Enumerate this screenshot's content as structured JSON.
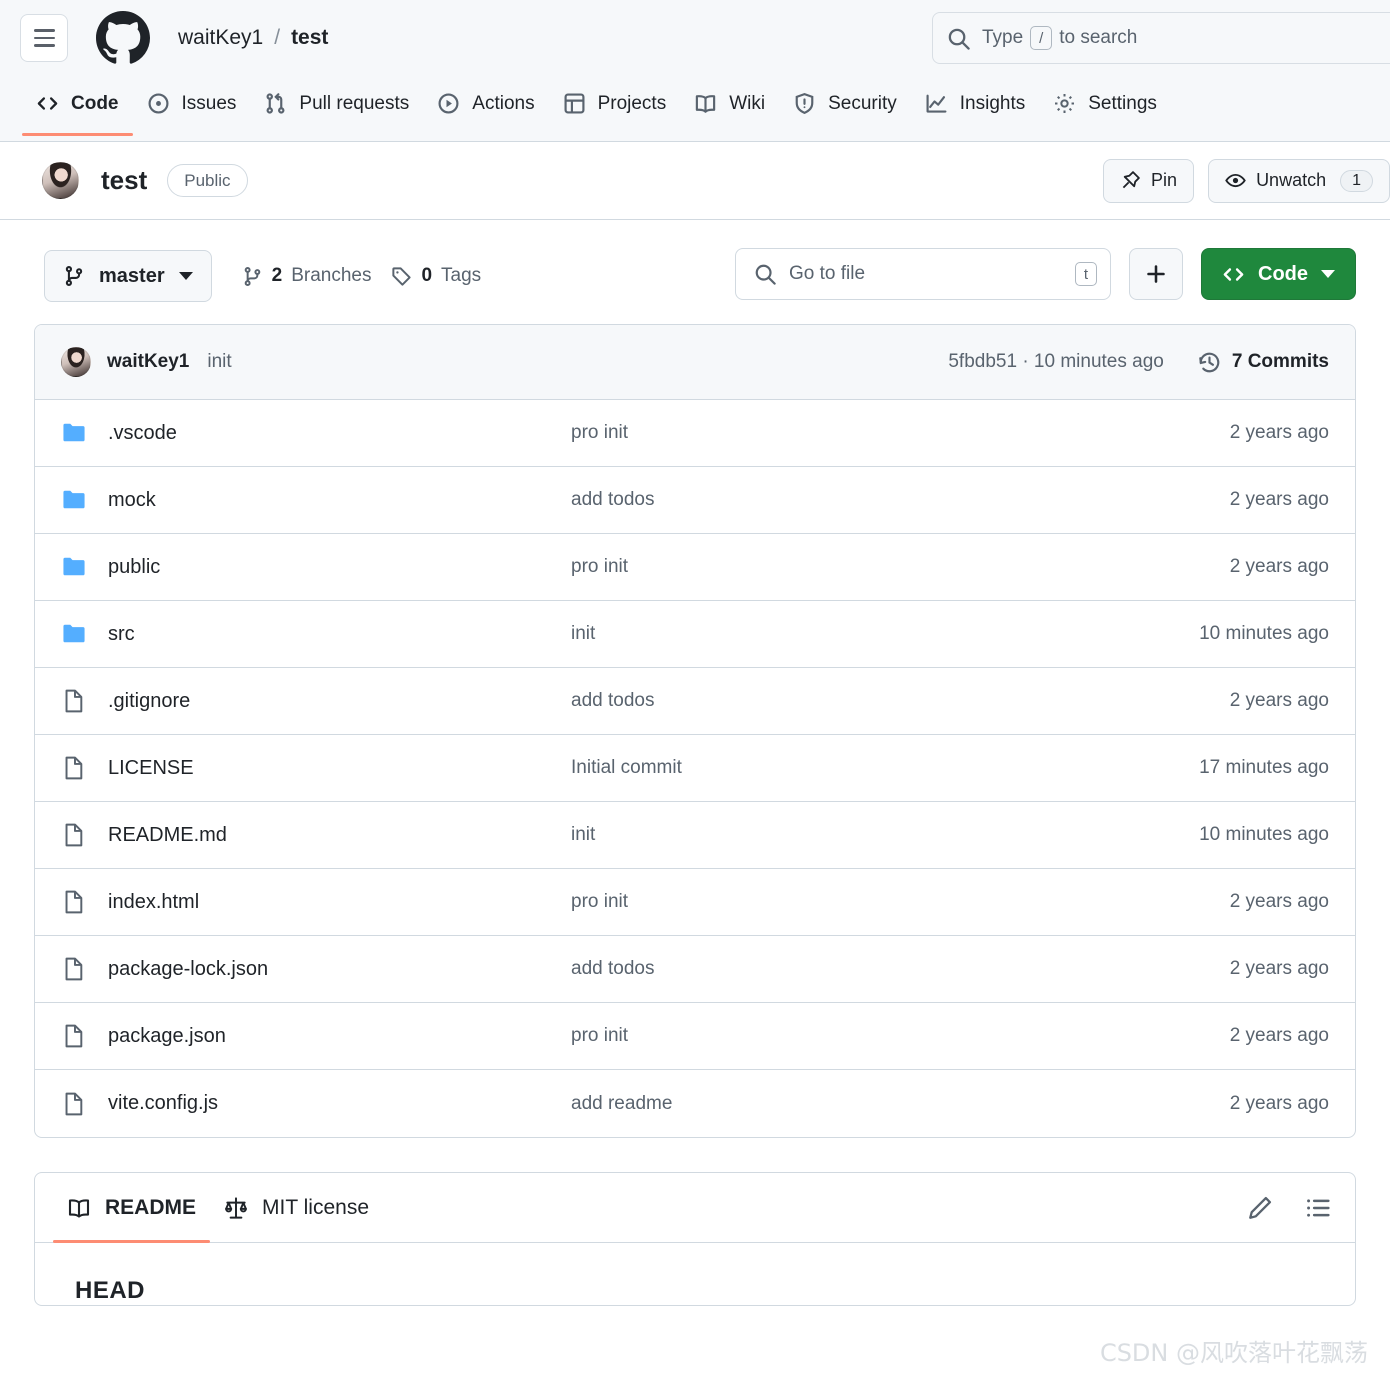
{
  "header": {
    "menu_icon": "hamburger-icon",
    "logo_icon": "github-logo-icon",
    "breadcrumb_owner": "waitKey1",
    "breadcrumb_separator": "/",
    "breadcrumb_repo": "test",
    "search": {
      "icon": "search-icon",
      "placeholder_before": "Type",
      "kbd": "/",
      "placeholder_after": "to search"
    }
  },
  "nav": {
    "tabs": [
      {
        "label": "Code",
        "icon": "code-icon",
        "active": true
      },
      {
        "label": "Issues",
        "icon": "issue-opened-icon",
        "active": false
      },
      {
        "label": "Pull requests",
        "icon": "git-pull-request-icon",
        "active": false
      },
      {
        "label": "Actions",
        "icon": "play-icon",
        "active": false
      },
      {
        "label": "Projects",
        "icon": "table-icon",
        "active": false
      },
      {
        "label": "Wiki",
        "icon": "book-icon",
        "active": false
      },
      {
        "label": "Security",
        "icon": "shield-icon",
        "active": false
      },
      {
        "label": "Insights",
        "icon": "graph-icon",
        "active": false
      },
      {
        "label": "Settings",
        "icon": "gear-icon",
        "active": false
      }
    ]
  },
  "repo": {
    "avatar": "owner-avatar",
    "name": "test",
    "visibility": "Public",
    "pin_label": "Pin",
    "pin_icon": "pin-icon",
    "watch_label": "Unwatch",
    "watch_icon": "eye-icon",
    "watch_count": "1"
  },
  "toolbar": {
    "branch_icon": "git-branch-icon",
    "branch_name": "master",
    "branches_count": "2",
    "branches_label": "Branches",
    "tags_icon": "tag-icon",
    "tags_count": "0",
    "tags_label": "Tags",
    "go_to_file_placeholder": "Go to file",
    "go_to_file_kbd": "t",
    "add_icon": "plus-icon",
    "code_button_label": "Code",
    "code_button_icon": "code-icon",
    "code_button_color": "#1f883d"
  },
  "commit_bar": {
    "avatar": "committer-avatar",
    "author": "waitKey1",
    "message": "init",
    "hash_and_time": "5fbdb51 · 10 minutes ago",
    "history_icon": "history-icon",
    "commits_label": "7 Commits"
  },
  "files": [
    {
      "name": ".vscode",
      "type": "folder",
      "icon": "folder-icon",
      "message": "pro init",
      "age": "2 years ago"
    },
    {
      "name": "mock",
      "type": "folder",
      "icon": "folder-icon",
      "message": "add todos",
      "age": "2 years ago"
    },
    {
      "name": "public",
      "type": "folder",
      "icon": "folder-icon",
      "message": "pro init",
      "age": "2 years ago"
    },
    {
      "name": "src",
      "type": "folder",
      "icon": "folder-icon",
      "message": "init",
      "age": "10 minutes ago"
    },
    {
      "name": ".gitignore",
      "type": "file",
      "icon": "file-icon",
      "message": "add todos",
      "age": "2 years ago"
    },
    {
      "name": "LICENSE",
      "type": "file",
      "icon": "file-icon",
      "message": "Initial commit",
      "age": "17 minutes ago"
    },
    {
      "name": "README.md",
      "type": "file",
      "icon": "file-icon",
      "message": "init",
      "age": "10 minutes ago"
    },
    {
      "name": "index.html",
      "type": "file",
      "icon": "file-icon",
      "message": "pro init",
      "age": "2 years ago"
    },
    {
      "name": "package-lock.json",
      "type": "file",
      "icon": "file-icon",
      "message": "add todos",
      "age": "2 years ago"
    },
    {
      "name": "package.json",
      "type": "file",
      "icon": "file-icon",
      "message": "pro init",
      "age": "2 years ago"
    },
    {
      "name": "vite.config.js",
      "type": "file",
      "icon": "file-icon",
      "message": "add readme",
      "age": "2 years ago"
    }
  ],
  "readme": {
    "tabs": [
      {
        "label": "README",
        "icon": "book-icon",
        "active": true
      },
      {
        "label": "MIT license",
        "icon": "law-icon",
        "active": false
      }
    ],
    "edit_icon": "pencil-icon",
    "outline_icon": "list-unordered-icon",
    "body_line": "HEAD",
    "accent_color": "#fd8c73"
  },
  "watermark": "CSDN @风吹落叶花飘荡"
}
